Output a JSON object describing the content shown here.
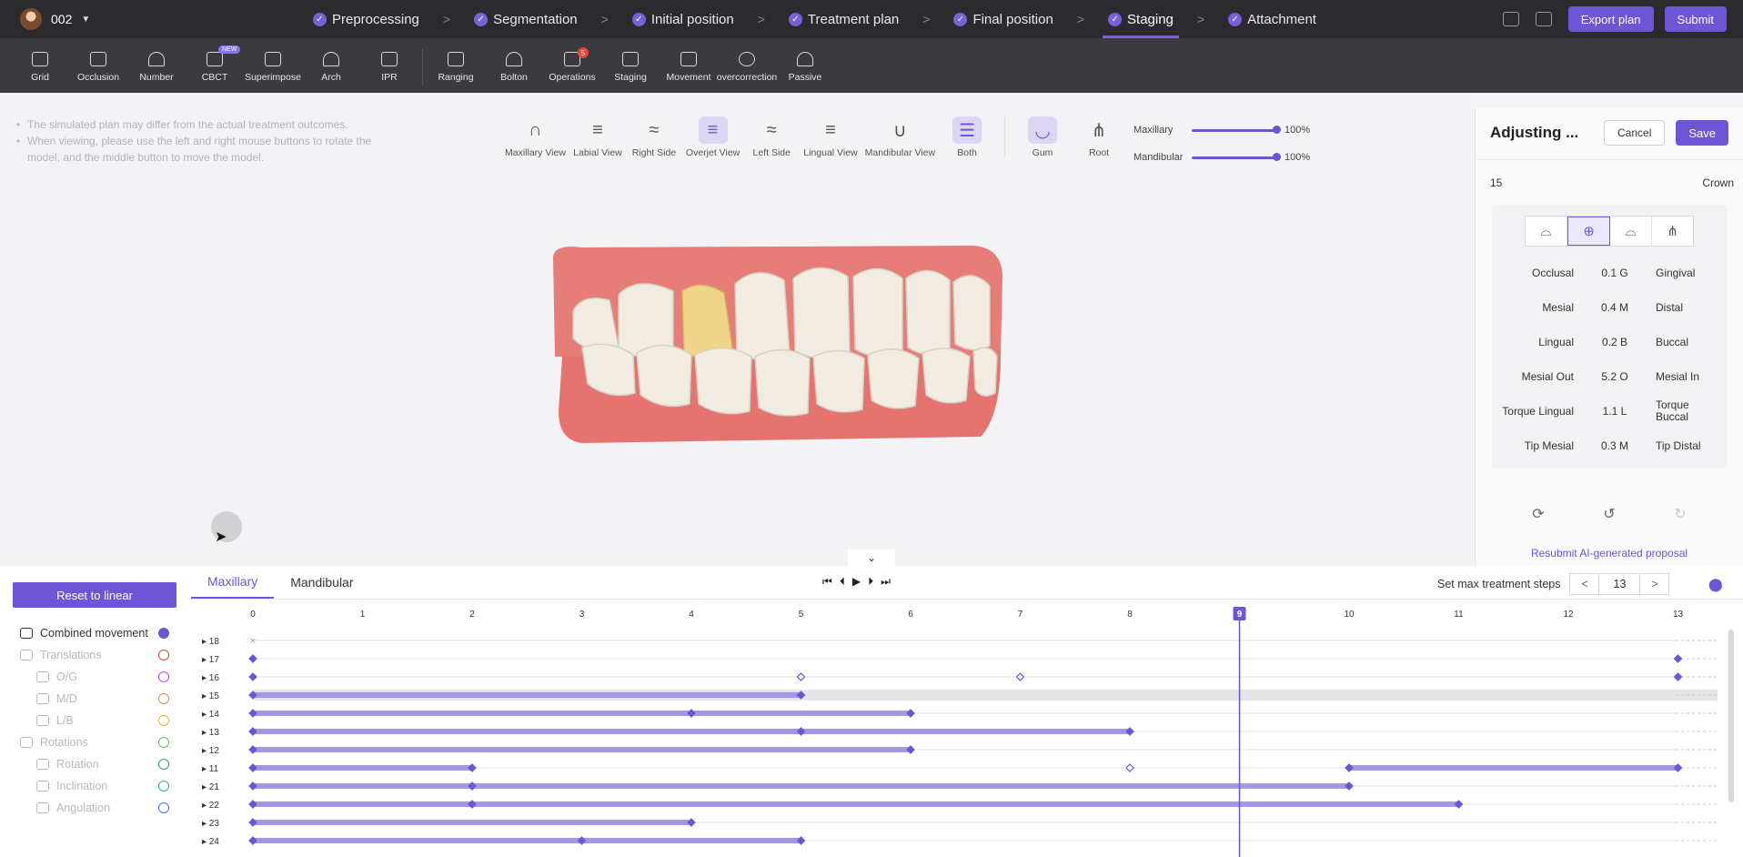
{
  "header": {
    "user": "002",
    "steps": [
      {
        "label": "Preprocessing",
        "done": true
      },
      {
        "label": "Segmentation",
        "done": true
      },
      {
        "label": "Initial position",
        "done": true
      },
      {
        "label": "Treatment plan",
        "done": true
      },
      {
        "label": "Final position",
        "done": true
      },
      {
        "label": "Staging",
        "done": true,
        "active": true
      },
      {
        "label": "Attachment",
        "done": true
      }
    ],
    "export_label": "Export plan",
    "submit_label": "Submit"
  },
  "toolbar": {
    "tools": [
      "Grid",
      "Occlusion",
      "Number",
      "CBCT",
      "Superimpose",
      "Arch",
      "IPR",
      "Ranging",
      "Bolton",
      "Operations",
      "Staging",
      "Movement",
      "overcorrection",
      "Passive"
    ],
    "cbct_badge": "NEW",
    "operations_badge": "5"
  },
  "viewport": {
    "notes": [
      "The simulated plan may differ from the actual treatment outcomes.",
      "When viewing, please use the left and right mouse buttons to rotate the model, and the middle button to move the model."
    ],
    "views": [
      "Maxillary View",
      "Labial View",
      "Right Side",
      "Overjet View",
      "Left Side",
      "Lingual View",
      "Mandibular View",
      "Both"
    ],
    "view_extras": [
      "Gum",
      "Root"
    ],
    "sliders": [
      {
        "label": "Maxillary",
        "value": "100%"
      },
      {
        "label": "Mandibular",
        "value": "100%"
      }
    ]
  },
  "panel": {
    "title": "Adjusting ...",
    "cancel": "Cancel",
    "save": "Save",
    "tooth_number": "15",
    "tooth_part": "Crown",
    "movements": [
      {
        "left": "Occlusal",
        "value": "0.1 G",
        "right": "Gingival"
      },
      {
        "left": "Mesial",
        "value": "0.4 M",
        "right": "Distal"
      },
      {
        "left": "Lingual",
        "value": "0.2 B",
        "right": "Buccal"
      },
      {
        "left": "Mesial Out",
        "value": "5.2 O",
        "right": "Mesial In"
      },
      {
        "left": "Torque Lingual",
        "value": "1.1 L",
        "right": "Torque Buccal"
      },
      {
        "left": "Tip Mesial",
        "value": "0.3 M",
        "right": "Tip Distal"
      }
    ],
    "resubmit": "Resubmit AI-generated proposal"
  },
  "timeline": {
    "reset": "Reset to linear",
    "tabs": [
      "Maxillary",
      "Mandibular"
    ],
    "max_steps_label": "Set max treatment steps",
    "max_steps": "13",
    "current_step": "9",
    "step_ticks": [
      "0",
      "1",
      "2",
      "3",
      "4",
      "5",
      "6",
      "7",
      "8",
      "9",
      "10",
      "11",
      "12",
      "13"
    ],
    "movement_types": [
      {
        "label": "Combined movement",
        "color": "#6d55d6"
      },
      {
        "label": "Translations",
        "color": "#e8453c"
      },
      {
        "label": "O/G",
        "color": "#c54fd6"
      },
      {
        "label": "M/D",
        "color": "#ef8a3a"
      },
      {
        "label": "L/B",
        "color": "#e8b423"
      },
      {
        "label": "Rotations",
        "color": "#6cc24a"
      },
      {
        "label": "Rotation",
        "color": "#2ca85a"
      },
      {
        "label": "Inclination",
        "color": "#26b5a8"
      },
      {
        "label": "Angulation",
        "color": "#4a6fe0"
      }
    ],
    "teeth": [
      "18",
      "17",
      "16",
      "15",
      "14",
      "13",
      "12",
      "11",
      "21",
      "22",
      "23",
      "24"
    ]
  }
}
